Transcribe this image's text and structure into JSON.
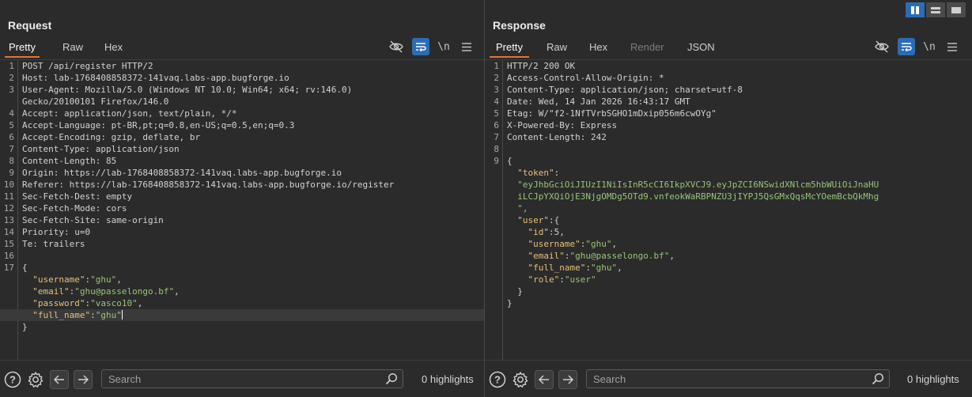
{
  "request": {
    "title": "Request",
    "tabs": [
      "Pretty",
      "Raw",
      "Hex"
    ],
    "lines": [
      "POST /api/register HTTP/2",
      "Host: lab-1768408858372-141vaq.labs-app.bugforge.io",
      "User-Agent: Mozilla/5.0 (Windows NT 10.0; Win64; x64; rv:146.0)",
      "Gecko/20100101 Firefox/146.0",
      "Accept: application/json, text/plain, */*",
      "Accept-Language: pt-BR,pt;q=0.8,en-US;q=0.5,en;q=0.3",
      "Accept-Encoding: gzip, deflate, br",
      "Content-Type: application/json",
      "Content-Length: 85",
      "Origin: https://lab-1768408858372-141vaq.labs-app.bugforge.io",
      "Referer: https://lab-1768408858372-141vaq.labs-app.bugforge.io/register",
      "Sec-Fetch-Dest: empty",
      "Sec-Fetch-Mode: cors",
      "Sec-Fetch-Site: same-origin",
      "Priority: u=0",
      "Te: trailers",
      "",
      "{",
      "  \"username\":\"ghu\",",
      "  \"email\":\"ghu@passelongo.bf\",",
      "  \"password\":\"vasco10\",",
      "  \"full_name\":\"ghu\"",
      "}"
    ],
    "line_numbers": [
      "1",
      "2",
      "3",
      "",
      "4",
      "5",
      "6",
      "7",
      "8",
      "9",
      "10",
      "11",
      "12",
      "13",
      "14",
      "15",
      "16",
      "17",
      "",
      "",
      "",
      "",
      ""
    ],
    "search_placeholder": "Search",
    "highlights": "0 highlights"
  },
  "response": {
    "title": "Response",
    "tabs": [
      "Pretty",
      "Raw",
      "Hex",
      "Render",
      "JSON Web Token"
    ],
    "lines": [
      "HTTP/2 200 OK",
      "Access-Control-Allow-Origin: *",
      "Content-Type: application/json; charset=utf-8",
      "Date: Wed, 14 Jan 2026 16:43:17 GMT",
      "Etag: W/\"f2-1NfTVrbSGHO1mDxip056m6cwOYg\"",
      "X-Powered-By: Express",
      "Content-Length: 242",
      "",
      "{",
      "  \"token\":",
      "  \"eyJhbGciOiJIUzI1NiIsInR5cCI6IkpXVCJ9.eyJpZCI6NSwidXNlcm5hbWUiOiJnaHU",
      "  iLCJpYXQiOjE3NjgOMDg5OTd9.vnfeokWaRBPNZU3jIYPJ5QsGMxQqsMcYOemBcbQkMhg",
      "  \",",
      "  \"user\":{",
      "    \"id\":5,",
      "    \"username\":\"ghu\",",
      "    \"email\":\"ghu@passelongo.bf\",",
      "    \"full_name\":\"ghu\",",
      "    \"role\":\"user\"",
      "  }",
      "}"
    ],
    "line_numbers": [
      "1",
      "2",
      "3",
      "4",
      "5",
      "6",
      "7",
      "8",
      "9",
      "",
      "",
      "",
      "",
      "",
      "",
      "",
      "",
      "",
      "",
      "",
      ""
    ],
    "search_placeholder": "Search",
    "highlights": "0 highlights"
  },
  "icons": {
    "hide": "eye-off-icon",
    "wrap": "word-wrap-icon",
    "newline": "\\n",
    "menu": "hamburger-menu-icon"
  },
  "colors": {
    "accent": "#e8732e",
    "active_blue": "#2c6cb5",
    "key": "#e5c07b",
    "string": "#98c379"
  }
}
